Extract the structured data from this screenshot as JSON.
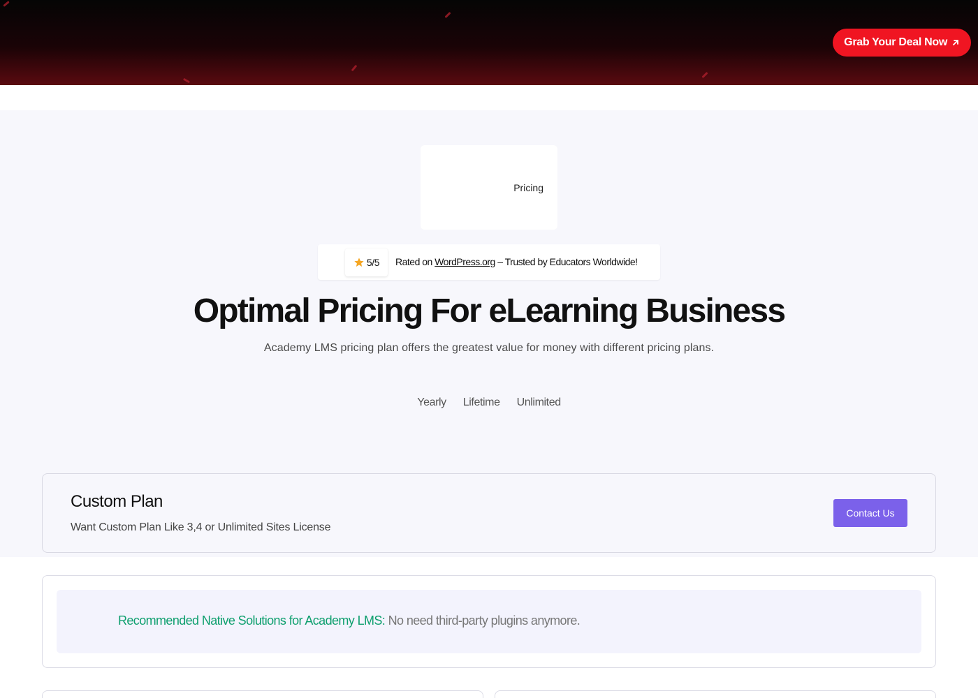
{
  "banner": {
    "deal_label": "Grab Your Deal Now"
  },
  "pricing_chip": {
    "label": "Pricing"
  },
  "rating": {
    "score": "5/5",
    "prefix": "Rated on ",
    "link": "WordPress.org",
    "suffix": " – Trusted by Educators Worldwide!"
  },
  "hero": {
    "title": "Optimal Pricing For eLearning Business",
    "subtitle": "Academy LMS pricing plan offers the greatest value for money with different pricing plans."
  },
  "period_tabs": [
    {
      "label": "Yearly"
    },
    {
      "label": "Lifetime"
    },
    {
      "label": "Unlimited"
    }
  ],
  "custom_plan": {
    "title": "Custom Plan",
    "description": "Want Custom Plan Like 3,4 or Unlimited Sites License",
    "button": "Contact Us"
  },
  "recommendation": {
    "highlight": "Recommended Native Solutions for Academy LMS:",
    "text": " No need third-party plugins anymore."
  },
  "colors": {
    "deal_red": "#f01522",
    "accent_purple": "#7b61ea",
    "recommend_green": "#0e9f6e",
    "hero_bg": "#f7f7fc"
  }
}
